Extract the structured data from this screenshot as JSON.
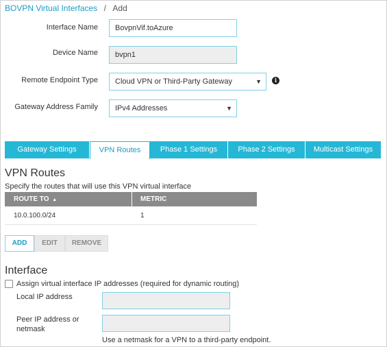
{
  "breadcrumb": {
    "link": "BOVPN Virtual Interfaces",
    "separator": "/",
    "current": "Add"
  },
  "form": {
    "interface_name": {
      "label": "Interface Name",
      "value": "BovpnVif.toAzure"
    },
    "device_name": {
      "label": "Device Name",
      "value": "bvpn1"
    },
    "remote_endpoint_type": {
      "label": "Remote Endpoint Type",
      "value": "Cloud VPN or Third-Party Gateway"
    },
    "gateway_address_family": {
      "label": "Gateway Address Family",
      "value": "IPv4 Addresses"
    }
  },
  "tabs": [
    "Gateway Settings",
    "VPN Routes",
    "Phase 1 Settings",
    "Phase 2 Settings",
    "Multicast Settings"
  ],
  "active_tab": "VPN Routes",
  "vpn_routes": {
    "title": "VPN Routes",
    "description": "Specify the routes that will use this VPN virtual interface",
    "columns": [
      "ROUTE TO",
      "METRIC"
    ],
    "sort_indicator": "▲",
    "rows": [
      {
        "route_to": "10.0.100.0/24",
        "metric": "1"
      }
    ],
    "buttons": {
      "add": "ADD",
      "edit": "EDIT",
      "remove": "REMOVE"
    }
  },
  "interface": {
    "title": "Interface",
    "assign_checkbox_label": "Assign virtual interface IP addresses (required for dynamic routing)",
    "assign_checked": false,
    "local_ip_label": "Local IP address",
    "local_ip_value": "",
    "peer_ip_label_line1": "Peer IP address or",
    "peer_ip_label_line2": "netmask",
    "peer_ip_value": "",
    "hint": "Use a netmask for a VPN to a third-party endpoint."
  },
  "colors": {
    "accent": "#25b7d6",
    "link": "#1a9cc4",
    "table_header": "#8a8a8a"
  },
  "icons": {
    "info": "info-icon",
    "select_caret": "chevron-down-icon",
    "sort": "sort-up-icon"
  }
}
